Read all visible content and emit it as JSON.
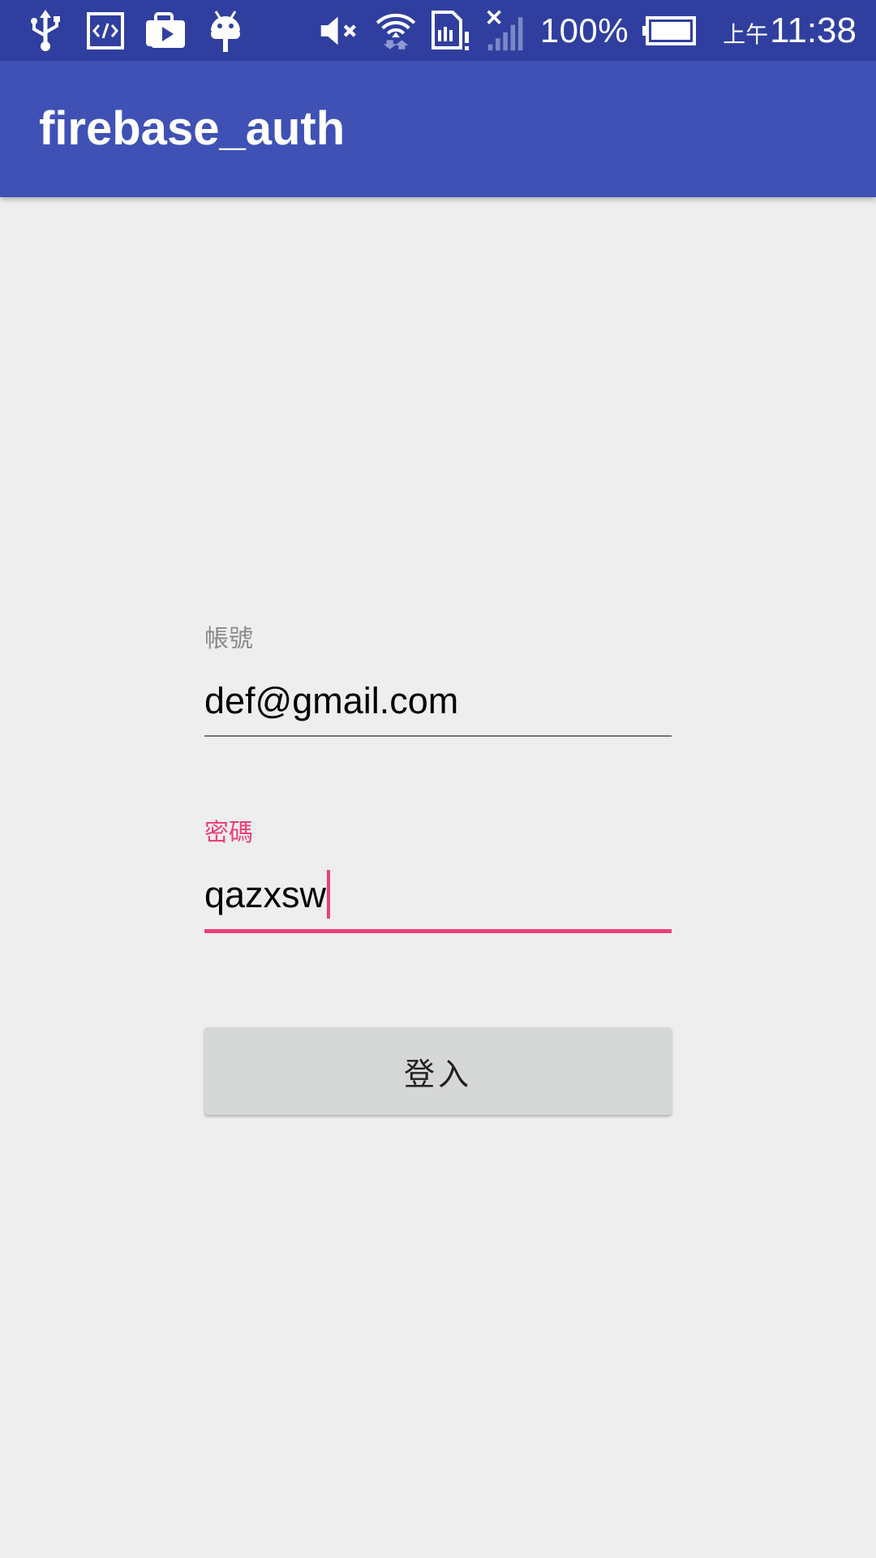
{
  "status_bar": {
    "left_icons": [
      "usb-icon",
      "code-icon",
      "play-store-icon",
      "android-icon"
    ],
    "right_icons": [
      "mute-icon",
      "wifi-icon",
      "sim-alert-icon",
      "no-signal-icon",
      "battery-icon"
    ],
    "battery_percent": "100%",
    "clock_ampm": "上午",
    "clock_time": "11:38"
  },
  "app_bar": {
    "title": "firebase_auth"
  },
  "form": {
    "account": {
      "label": "帳號",
      "value": "def@gmail.com"
    },
    "password": {
      "label": "密碼",
      "value": "qazxsw"
    },
    "login_button_label": "登入"
  },
  "colors": {
    "status_bar": "#303f9f",
    "primary": "#3f51b5",
    "accent": "#ec407a",
    "background": "#eeeeee",
    "button": "#d6d7d7"
  }
}
